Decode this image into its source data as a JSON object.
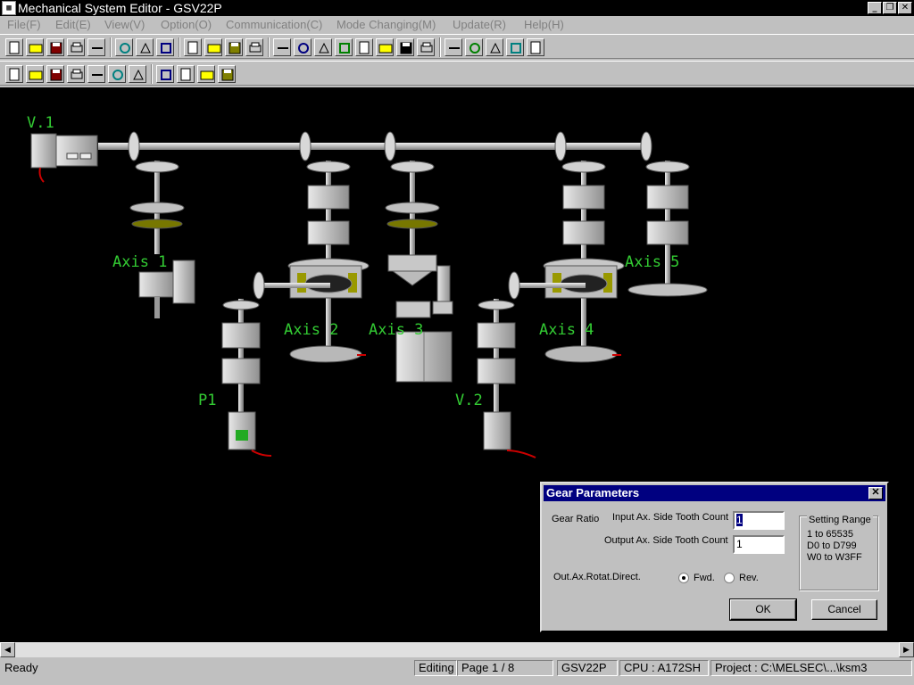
{
  "window": {
    "title": "Mechanical System Editor - GSV22P",
    "app_icon": "pc-icon",
    "controls": [
      "minimize",
      "restore",
      "close"
    ]
  },
  "menu": [
    "File(F)",
    "Edit(E)",
    "View(V)",
    "Option(O)",
    "Communication(C)",
    "Mode Changing(M)",
    "Update(R)",
    "Help(H)"
  ],
  "toolbar1_icons": [
    "new-file-icon",
    "open-folder-icon",
    "save-icon",
    "print-preview-icon",
    "print-icon",
    "cut-icon",
    "copy-icon",
    "paste-icon",
    "drive-shaft-icon",
    "gear-icon",
    "clutch-icon",
    "speed-change-icon",
    "line-icon",
    "branch-icon",
    "connect-icon",
    "virtual-axis-icon",
    "differential-icon",
    "transmission-icon",
    "roller-icon",
    "ball-screw-icon",
    "rotary-table-icon",
    "cam-icon",
    "scroll-left-icon",
    "grid-icon",
    "scroll-right-icon"
  ],
  "toolbar2_icons": [
    "project-icon",
    "parameter-icon",
    "list-icon",
    "monitor-icon",
    "window-icon",
    "display-icon",
    "help-icon",
    "test-icon",
    "graph-icon",
    "table-icon",
    "layout-icon"
  ],
  "diagram": {
    "labels": [
      "V.1",
      "Axis 1",
      "Axis 2",
      "Axis 3",
      "Axis 4",
      "Axis 5",
      "P1",
      "V.2"
    ],
    "label_color": "#33cc33",
    "background": "#000000"
  },
  "dialog": {
    "title": "Gear Parameters",
    "gear_ratio_label": "Gear Ratio",
    "input_label": "Input Ax. Side Tooth Count",
    "input_value": "1",
    "output_label": "Output Ax. Side Tooth Count",
    "output_value": "1",
    "range_title": "Setting Range",
    "range_lines": [
      "1 to 65535",
      "D0 to D799",
      "W0 to W3FF"
    ],
    "direction_label": "Out.Ax.Rotat.Direct.",
    "fwd_label": "Fwd.",
    "rev_label": "Rev.",
    "selected_direction": "Fwd.",
    "ok_label": "OK",
    "cancel_label": "Cancel"
  },
  "status": {
    "ready": "Ready",
    "mode": "Editing",
    "page": "Page  1 / 8",
    "model": "GSV22P",
    "cpu": "CPU : A172SH",
    "project": "Project : C:\\MELSEC\\...\\ksm3"
  }
}
